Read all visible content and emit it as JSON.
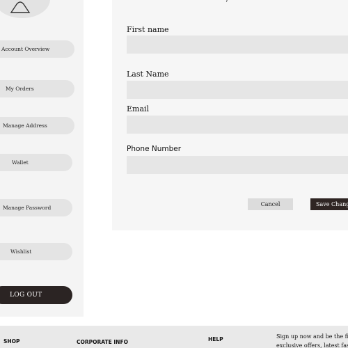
{
  "sidebar": {
    "items": [
      {
        "label": "Account Overview"
      },
      {
        "label": "My Orders"
      },
      {
        "label": "Manage Address"
      },
      {
        "label": "Wallet"
      },
      {
        "label": "Manage Password"
      },
      {
        "label": "Wishlist"
      }
    ],
    "logout_label": "LOG OUT"
  },
  "form": {
    "first_name_label": "First name",
    "last_name_label": "Last Name",
    "email_label": "Email",
    "phone_label": "Phone Number",
    "cancel_label": "Cancel",
    "save_label": "Save Changes"
  },
  "footer": {
    "shop": "SHOP",
    "corporate": "CORPORATE INFO",
    "help": "HELP",
    "signup_line1": "Sign up now and be the first",
    "signup_line2": "exclusive offers, latest fashion"
  }
}
